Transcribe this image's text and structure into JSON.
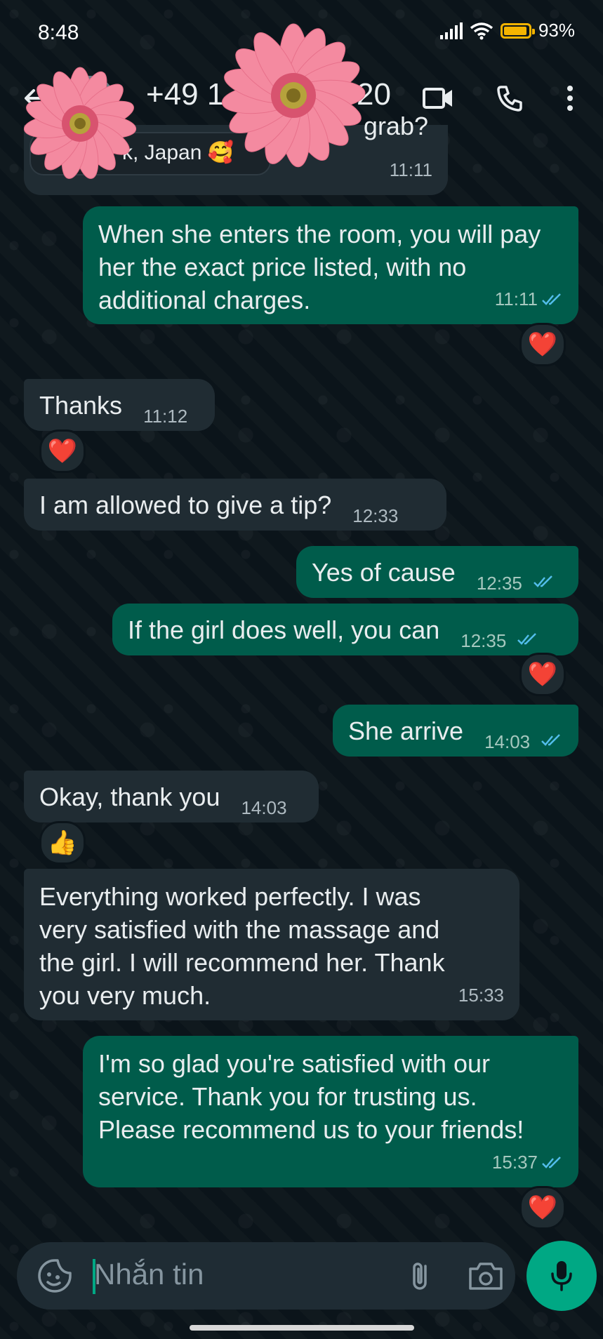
{
  "status_bar": {
    "time": "8:48",
    "battery": "93%"
  },
  "header": {
    "contact_left": "+49 1",
    "contact_right": "20"
  },
  "messages": [
    {
      "id": "m0",
      "direction": "in",
      "partial_text": "grab?",
      "location_text": "k, Japan 🥰",
      "time": "11:11"
    },
    {
      "id": "m1",
      "direction": "out",
      "text": "When she enters the room, you will pay her the exact price listed, with no additional charges.",
      "time": "11:11",
      "reaction": "❤️"
    },
    {
      "id": "m2",
      "direction": "in",
      "text": "Thanks",
      "time": "11:12",
      "reaction": "❤️"
    },
    {
      "id": "m3",
      "direction": "in",
      "text": "I am allowed to give a tip?",
      "time": "12:33"
    },
    {
      "id": "m4",
      "direction": "out",
      "text": "Yes of cause",
      "time": "12:35"
    },
    {
      "id": "m5",
      "direction": "out",
      "text": "If the girl does well, you can",
      "time": "12:35",
      "reaction": "❤️"
    },
    {
      "id": "m6",
      "direction": "out",
      "text": "She arrive",
      "time": "14:03"
    },
    {
      "id": "m7",
      "direction": "in",
      "text": "Okay, thank you",
      "time": "14:03",
      "reaction": "👍"
    },
    {
      "id": "m8",
      "direction": "in",
      "text": "Everything worked perfectly. I was very satisfied with the massage and the girl. I will recommend her. Thank you very much.",
      "time": "15:33"
    },
    {
      "id": "m9",
      "direction": "out",
      "text": "I'm so glad you're satisfied with our service. Thank you for trusting us. Please recommend us to your friends!",
      "time": "15:37",
      "reaction": "❤️"
    }
  ],
  "input": {
    "placeholder": "Nhắn tin"
  },
  "colors": {
    "incoming": "#202c33",
    "outgoing": "#005c4b",
    "accent": "#00a884",
    "background": "#0b141a"
  },
  "icons": [
    "back-arrow-icon",
    "video-call-icon",
    "phone-call-icon",
    "more-options-icon",
    "emoji-sticker-icon",
    "attach-icon",
    "camera-icon",
    "mic-icon",
    "read-ticks-icon"
  ]
}
